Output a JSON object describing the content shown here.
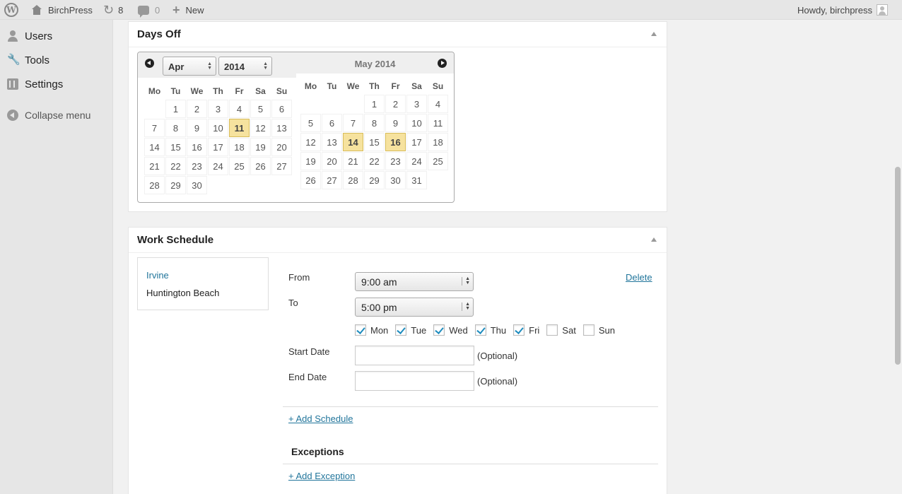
{
  "adminbar": {
    "site_name": "BirchPress",
    "updates_count": "8",
    "comments_count": "0",
    "new_label": "New",
    "howdy": "Howdy, birchpress"
  },
  "menu": {
    "users": "Users",
    "tools": "Tools",
    "settings": "Settings",
    "collapse": "Collapse menu"
  },
  "days_off": {
    "title": "Days Off",
    "month_select": "Apr",
    "year_select": "2014",
    "right_title": "May 2014",
    "weekdays": [
      "Mo",
      "Tu",
      "We",
      "Th",
      "Fr",
      "Sa",
      "Su"
    ],
    "april_weeks": [
      [
        "",
        "1",
        "2",
        "3",
        "4",
        "5",
        "6"
      ],
      [
        "7",
        "8",
        "9",
        "10",
        "11",
        "12",
        "13"
      ],
      [
        "14",
        "15",
        "16",
        "17",
        "18",
        "19",
        "20"
      ],
      [
        "21",
        "22",
        "23",
        "24",
        "25",
        "26",
        "27"
      ],
      [
        "28",
        "29",
        "30",
        "",
        "",
        "",
        ""
      ]
    ],
    "may_weeks": [
      [
        "",
        "",
        "",
        "1",
        "2",
        "3",
        "4"
      ],
      [
        "5",
        "6",
        "7",
        "8",
        "9",
        "10",
        "11"
      ],
      [
        "12",
        "13",
        "14",
        "15",
        "16",
        "17",
        "18"
      ],
      [
        "19",
        "20",
        "21",
        "22",
        "23",
        "24",
        "25"
      ],
      [
        "26",
        "27",
        "28",
        "29",
        "30",
        "31",
        ""
      ]
    ],
    "april_selected": [
      "11"
    ],
    "may_selected": [
      "14",
      "16"
    ]
  },
  "work_schedule": {
    "title": "Work Schedule",
    "locations": [
      "Irvine",
      "Huntington Beach"
    ],
    "from_label": "From",
    "from_value": "9:00 am",
    "to_label": "To",
    "to_value": "5:00 pm",
    "delete_label": "Delete",
    "days": [
      {
        "label": "Mon",
        "checked": true
      },
      {
        "label": "Tue",
        "checked": true
      },
      {
        "label": "Wed",
        "checked": true
      },
      {
        "label": "Thu",
        "checked": true
      },
      {
        "label": "Fri",
        "checked": true
      },
      {
        "label": "Sat",
        "checked": false
      },
      {
        "label": "Sun",
        "checked": false
      }
    ],
    "start_date_label": "Start Date",
    "end_date_label": "End Date",
    "optional_label": "(Optional)",
    "add_schedule": "+ Add Schedule",
    "exceptions_title": "Exceptions",
    "add_exception": "+ Add Exception"
  }
}
